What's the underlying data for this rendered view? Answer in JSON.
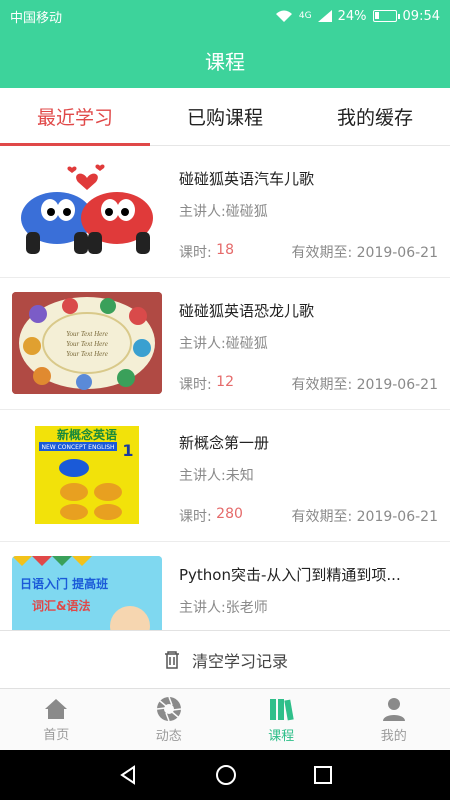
{
  "status_bar": {
    "carrier": "中国移动",
    "network": "4G",
    "battery": "24%",
    "battery_level": 0.24,
    "time": "09:54"
  },
  "app_bar": {
    "title": "课程"
  },
  "tabs": [
    {
      "label": "最近学习",
      "active": true
    },
    {
      "label": "已购课程",
      "active": false
    },
    {
      "label": "我的缓存",
      "active": false
    }
  ],
  "courses": [
    {
      "title": "碰碰狐英语汽车儿歌",
      "teacher_label": "主讲人:",
      "teacher": "碰碰狐",
      "hours_label": "课时:",
      "hours": "18",
      "valid_label": "有效期至:",
      "valid_until": "2019-06-21",
      "thumb": "cartoon-cars"
    },
    {
      "title": "碰碰狐英语恐龙儿歌",
      "teacher_label": "主讲人:",
      "teacher": "碰碰狐",
      "hours_label": "课时:",
      "hours": "12",
      "valid_label": "有效期至:",
      "valid_until": "2019-06-21",
      "thumb": "cartoon-dinosaurs",
      "thumb_text": [
        "Your Text Here",
        "Your Text Here",
        "Your Text Here"
      ]
    },
    {
      "title": "新概念第一册",
      "teacher_label": "主讲人:",
      "teacher": "未知",
      "hours_label": "课时:",
      "hours": "280",
      "valid_label": "有效期至:",
      "valid_until": "2019-06-21",
      "thumb": "book-cover",
      "thumb_text": [
        "新概念英语",
        "NEW CONCEPT ENGLISH",
        "1"
      ]
    },
    {
      "title": "Python突击-从入门到精通到项...",
      "teacher_label": "主讲人:",
      "teacher": "张老师",
      "thumb": "banner",
      "thumb_text": [
        "日语入门 提高班",
        "词汇&语法"
      ]
    }
  ],
  "clear_history": {
    "label": "清空学习记录",
    "icon": "trash-icon"
  },
  "bottom_nav": [
    {
      "label": "首页",
      "icon": "home-icon",
      "active": false
    },
    {
      "label": "动态",
      "icon": "aperture-icon",
      "active": false
    },
    {
      "label": "课程",
      "icon": "books-icon",
      "active": true
    },
    {
      "label": "我的",
      "icon": "person-icon",
      "active": false
    }
  ],
  "colors": {
    "accent": "#3dd39b",
    "tab_active": "#e04848",
    "hours": "#e56a6a"
  }
}
